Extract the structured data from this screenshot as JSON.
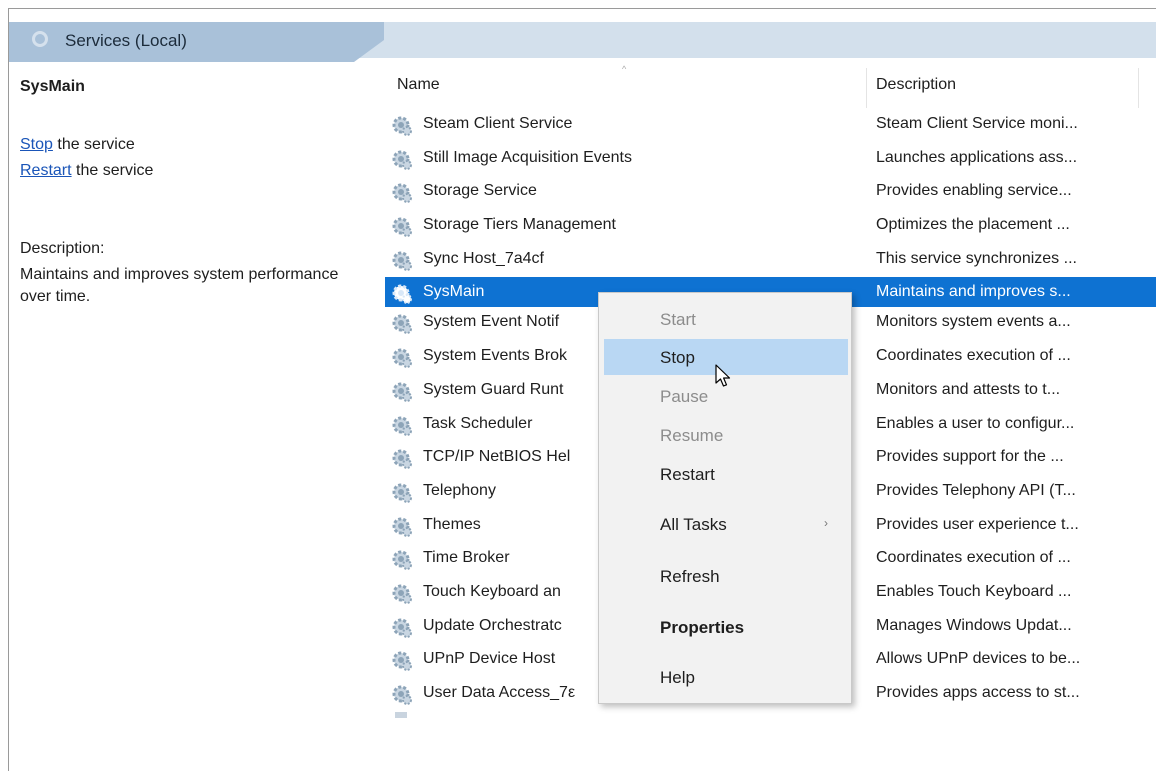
{
  "header": {
    "title": "Services (Local)"
  },
  "left_pane": {
    "service_name": "SysMain",
    "stop_link": "Stop",
    "stop_suffix": " the service",
    "restart_link": "Restart",
    "restart_suffix": " the service",
    "description_label": "Description:",
    "description_text": "Maintains and improves system performance over time."
  },
  "columns": {
    "name": "Name",
    "description": "Description"
  },
  "rows": [
    {
      "name": "Steam Client Service",
      "description": "Steam Client Service moni..."
    },
    {
      "name": "Still Image Acquisition Events",
      "description": "Launches applications ass..."
    },
    {
      "name": "Storage Service",
      "description": "Provides enabling service..."
    },
    {
      "name": "Storage Tiers Management",
      "description": "Optimizes the placement ..."
    },
    {
      "name": "Sync Host_7a4cf",
      "description": "This service synchronizes ..."
    },
    {
      "name": "SysMain",
      "description": "Maintains and improves s...",
      "selected": true
    },
    {
      "name": "System Event Notif",
      "description": "Monitors system events a..."
    },
    {
      "name": "System Events Brok",
      "description": "Coordinates execution of ..."
    },
    {
      "name": "System Guard Runt",
      "description": "Monitors and attests to t..."
    },
    {
      "name": "Task Scheduler",
      "description": "Enables a user to configur..."
    },
    {
      "name": "TCP/IP NetBIOS Hel",
      "description": "Provides support for the ..."
    },
    {
      "name": "Telephony",
      "description": "Provides Telephony API (T..."
    },
    {
      "name": "Themes",
      "description": "Provides user experience t..."
    },
    {
      "name": "Time Broker",
      "description": "Coordinates execution of ..."
    },
    {
      "name": "Touch Keyboard an",
      "description": "Enables Touch Keyboard ..."
    },
    {
      "name": "Update Orchestratc",
      "description": "Manages Windows Updat..."
    },
    {
      "name": "UPnP Device Host",
      "description": "Allows UPnP devices to be..."
    },
    {
      "name": "User Data Access_7ε",
      "description": "Provides apps access to st..."
    }
  ],
  "context_menu": {
    "start": "Start",
    "stop": "Stop",
    "pause": "Pause",
    "resume": "Resume",
    "restart": "Restart",
    "all_tasks": "All Tasks",
    "all_tasks_arrow": "›",
    "refresh": "Refresh",
    "properties": "Properties",
    "help": "Help"
  },
  "colors": {
    "selection": "#0e72d2",
    "menu_hover": "#b9d7f3",
    "link": "#1a55b8",
    "header_tab": "#a9c1d9"
  },
  "icons": {
    "service": "gear-icon",
    "pointer": "cursor-arrow-icon",
    "header": "magnifier-icon"
  }
}
